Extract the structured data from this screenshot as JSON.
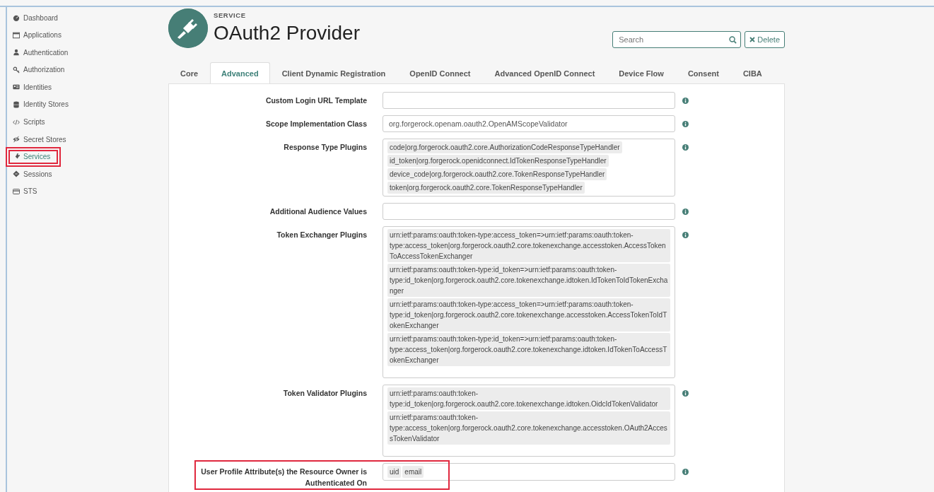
{
  "sidebar": {
    "items": [
      {
        "label": "Dashboard",
        "selected": false,
        "highlighted": false
      },
      {
        "label": "Applications",
        "selected": false,
        "highlighted": false
      },
      {
        "label": "Authentication",
        "selected": false,
        "highlighted": false
      },
      {
        "label": "Authorization",
        "selected": false,
        "highlighted": false
      },
      {
        "label": "Identities",
        "selected": false,
        "highlighted": false
      },
      {
        "label": "Identity Stores",
        "selected": false,
        "highlighted": false
      },
      {
        "label": "Scripts",
        "selected": false,
        "highlighted": false
      },
      {
        "label": "Secret Stores",
        "selected": false,
        "highlighted": false
      },
      {
        "label": "Services",
        "selected": true,
        "highlighted": true
      },
      {
        "label": "Sessions",
        "selected": false,
        "highlighted": false
      },
      {
        "label": "STS",
        "selected": false,
        "highlighted": false
      }
    ]
  },
  "header": {
    "kicker": "SERVICE",
    "title": "OAuth2 Provider",
    "search": {
      "placeholder": "Search"
    },
    "delete_button": "Delete"
  },
  "tabs": [
    {
      "label": "Core",
      "selected": false
    },
    {
      "label": "Advanced",
      "selected": true
    },
    {
      "label": "Client Dynamic Registration",
      "selected": false
    },
    {
      "label": "OpenID Connect",
      "selected": false
    },
    {
      "label": "Advanced OpenID Connect",
      "selected": false
    },
    {
      "label": "Device Flow",
      "selected": false
    },
    {
      "label": "Consent",
      "selected": false
    },
    {
      "label": "CIBA",
      "selected": false
    }
  ],
  "fields": [
    {
      "label": "Custom Login URL Template",
      "kind": "text",
      "highlighted": false
    },
    {
      "label": "Scope Implementation Class",
      "kind": "text",
      "value": "org.forgerock.openam.oauth2.OpenAMScopeValidator",
      "highlighted": false
    },
    {
      "label": "Response Type Plugins",
      "kind": "tags",
      "highlighted": false,
      "tags": [
        "code|org.forgerock.oauth2.core.AuthorizationCodeResponseTypeHandler",
        "id_token|org.forgerock.openidconnect.IdTokenResponseTypeHandler",
        "device_code|org.forgerock.oauth2.core.TokenResponseTypeHandler",
        "token|org.forgerock.oauth2.core.TokenResponseTypeHandler"
      ]
    },
    {
      "label": "Additional Audience Values",
      "kind": "tags",
      "highlighted": false
    },
    {
      "label": "Token Exchanger Plugins",
      "kind": "tags",
      "highlighted": false,
      "tags": [
        "urn:ietf:params:oauth:token-type:access_token=>urn:ietf:params:oauth:token-type:access_token|org.forgerock.oauth2.core.tokenexchange.accesstoken.AccessTokenToAccessTokenExchanger",
        "urn:ietf:params:oauth:token-type:id_token=>urn:ietf:params:oauth:token-type:id_token|org.forgerock.oauth2.core.tokenexchange.idtoken.IdTokenToIdTokenExchanger",
        "urn:ietf:params:oauth:token-type:access_token=>urn:ietf:params:oauth:token-type:id_token|org.forgerock.oauth2.core.tokenexchange.accesstoken.AccessTokenToIdTokenExchanger",
        "urn:ietf:params:oauth:token-type:id_token=>urn:ietf:params:oauth:token-type:access_token|org.forgerock.oauth2.core.tokenexchange.idtoken.IdTokenToAccessTokenExchanger"
      ]
    },
    {
      "label": "Token Validator Plugins",
      "kind": "tags",
      "highlighted": false,
      "tags": [
        "urn:ietf:params:oauth:token-type:id_token|org.forgerock.oauth2.core.tokenexchange.idtoken.OidcIdTokenValidator",
        "urn:ietf:params:oauth:token-type:access_token|org.forgerock.oauth2.core.tokenexchange.accesstoken.OAuth2AccessTokenValidator"
      ]
    },
    {
      "label": "User Profile Attribute(s) the Resource Owner is Authenticated On",
      "kind": "tags",
      "highlighted": true,
      "tags": [
        "uid",
        "email"
      ]
    }
  ]
}
